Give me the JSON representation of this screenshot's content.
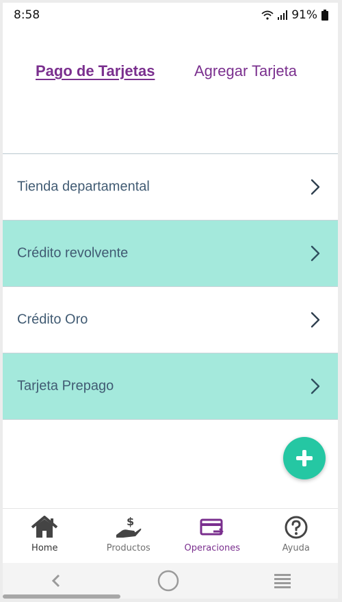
{
  "status_bar": {
    "time": "8:58",
    "battery": "91%"
  },
  "tabs": [
    {
      "label": "Pago de Tarjetas",
      "active": true
    },
    {
      "label": "Agregar Tarjeta",
      "active": false
    }
  ],
  "list": [
    {
      "label": "Tienda departamental"
    },
    {
      "label": "Crédito revolvente"
    },
    {
      "label": "Crédito Oro"
    },
    {
      "label": "Tarjeta Prepago"
    }
  ],
  "fab": {
    "icon": "plus-icon"
  },
  "bottom_nav": [
    {
      "label": "Home",
      "icon": "home-icon"
    },
    {
      "label": "Productos",
      "icon": "hand-money-icon"
    },
    {
      "label": "Operaciones",
      "icon": "card-transfer-icon",
      "active": true
    },
    {
      "label": "Ayuda",
      "icon": "help-icon"
    }
  ],
  "colors": {
    "brand_purple": "#7a2f8e",
    "accent_teal": "#25c7a3",
    "row_highlight": "#a4e9dc",
    "text_slate": "#415b73"
  }
}
